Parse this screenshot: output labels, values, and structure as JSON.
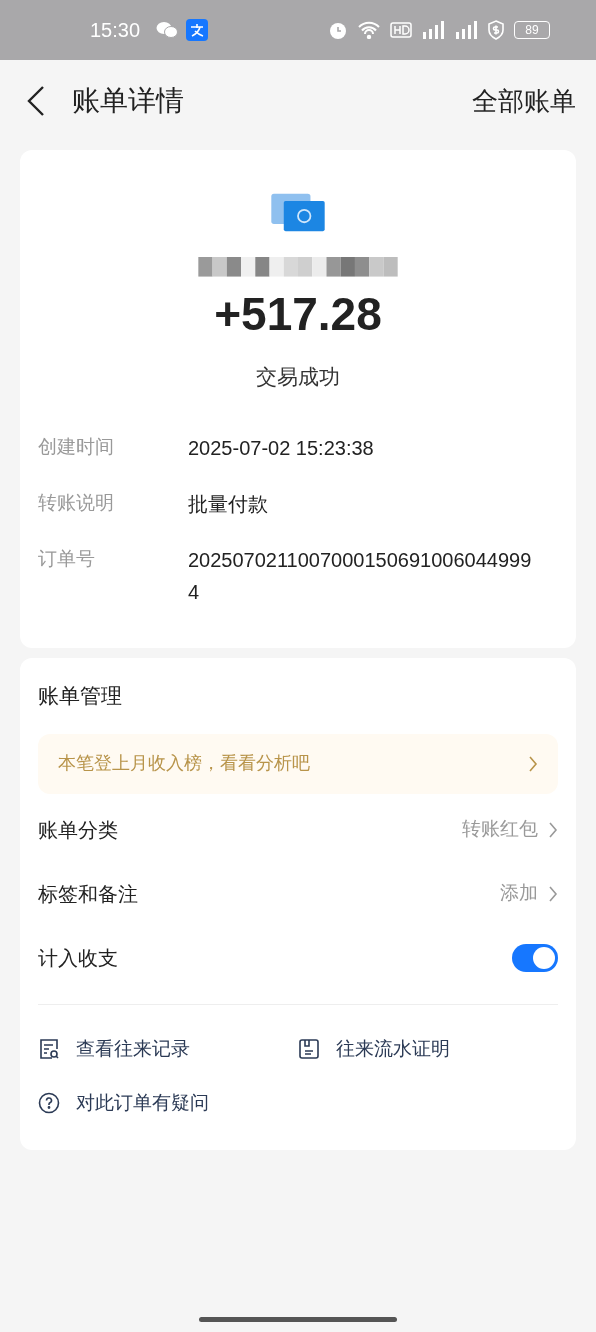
{
  "status_bar": {
    "time": "15:30",
    "battery": "89"
  },
  "header": {
    "title": "账单详情",
    "action": "全部账单"
  },
  "summary": {
    "amount": "+517.28",
    "status": "交易成功",
    "details": [
      {
        "label": "创建时间",
        "value": "2025-07-02 15:23:38"
      },
      {
        "label": "转账说明",
        "value": "批量付款"
      },
      {
        "label": "订单号",
        "value": "20250702110070001506910060449994"
      }
    ]
  },
  "management": {
    "title": "账单管理",
    "banner": "本笔登上月收入榜，看看分析吧",
    "rows": [
      {
        "kind": "link",
        "label": "账单分类",
        "value": "转账红包"
      },
      {
        "kind": "link",
        "label": "标签和备注",
        "value": "添加"
      },
      {
        "kind": "toggle",
        "label": "计入收支",
        "on": true
      }
    ],
    "links": [
      {
        "kind": "records",
        "label": "查看往来记录"
      },
      {
        "kind": "proof",
        "label": "往来流水证明"
      },
      {
        "kind": "question",
        "label": "对此订单有疑问"
      }
    ]
  }
}
